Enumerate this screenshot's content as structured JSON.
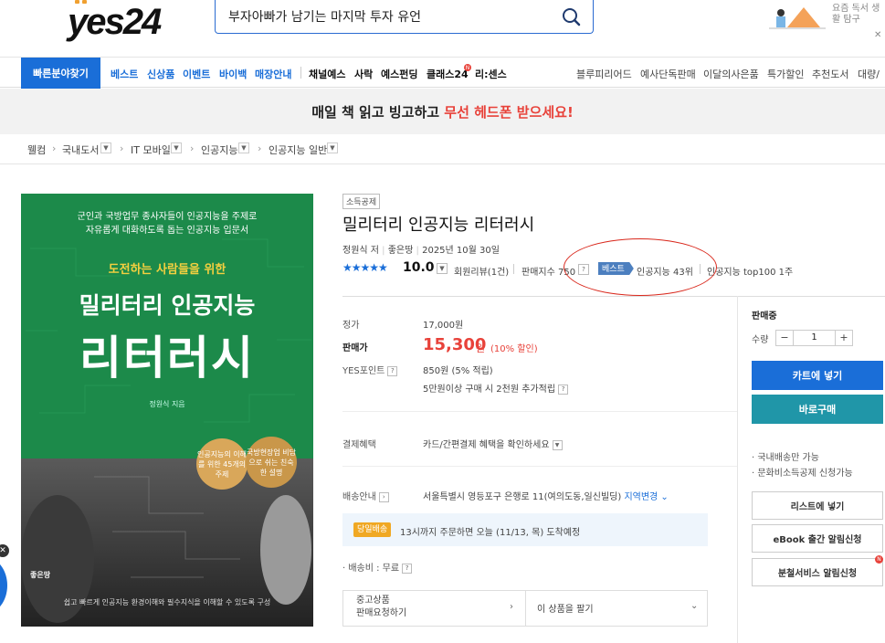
{
  "header": {
    "logo": "yes24",
    "search_value": "부자아빠가 남기는 마지막 투자 유언",
    "promo_text": "요즘 독서 생활 탐구"
  },
  "nav": {
    "quick_button": "빠른분야찾기",
    "blue_items": [
      "베스트",
      "신상품",
      "이벤트",
      "바이백",
      "매장안내"
    ],
    "dark_items": [
      "채널예스",
      "사락",
      "예스펀딩",
      "클래스24",
      "리:센스"
    ],
    "gray_items": [
      "블루피리어드",
      "예사단독판매",
      "이달의사은품",
      "특가할인",
      "추천도서",
      "대량/"
    ]
  },
  "banner": {
    "text_black": "매일 책 읽고 빙고하고 ",
    "text_red": "무선 헤드폰 받으세요!"
  },
  "breadcrumb": [
    "웰컴",
    "국내도서",
    "IT 모바일",
    "인공지능",
    "인공지능 일반"
  ],
  "cover": {
    "subtitle_line1": "군인과 국방업무 종사자들이 인공지능을 주제로",
    "subtitle_line2": "자유롭게 대화하도록 돕는 인공지능 입문서",
    "kicker": "도전하는 사람들을 위한",
    "title1": "밀리터리 인공지능",
    "title2": "리터러시",
    "author": "정원식 지음",
    "circle1": "인공지능의 이해를 위한 45개의 주제",
    "circle2": "국방현장업 비담으로 쉬는 친숙한 설명",
    "footer": "쉽고 빠르게 인공지능 환경이해와 필수지식을 이해할 수 있도록 구성",
    "publisher": "좋은땅"
  },
  "product": {
    "tag": "소득공제",
    "title": "밀리터리 인공지능 리터러시",
    "author": "정원식 저",
    "publisher": "좋은땅",
    "date": "2025년 10월 30일",
    "stars": "★★★★★",
    "score": "10.0",
    "reviews": "회원리뷰(1건)",
    "sales_index": "판매지수 750",
    "best_badge": "베스트",
    "rank1": "인공지능 43위",
    "rank2": "인공지능 top100 1주"
  },
  "price": {
    "list_label": "정가",
    "list_value": "17,000원",
    "sale_label": "판매가",
    "sale_value": "15,300",
    "sale_unit": "원",
    "discount": "(10% 할인)",
    "point_label": "YES포인트",
    "point_value": "850원 (5% 적립)",
    "point_extra": "5만원이상 구매 시 2천원 추가적립"
  },
  "benefit": {
    "label": "결제혜택",
    "value": "카드/간편결제 혜택을 확인하세요"
  },
  "delivery": {
    "label": "배송안내",
    "address": "서울특별시 영등포구 은행로 11(여의도동,일신빌딩)",
    "change": "지역변경",
    "sameday_badge": "당일배송",
    "sameday_text": "13시까지 주문하면 오늘 (11/13, 목) 도착예정",
    "fee": "· 배송비 : 무료"
  },
  "used": {
    "left_line1": "중고상품",
    "left_line2": "판매요청하기",
    "right": "이 상품을 팔기"
  },
  "side": {
    "status": "판매중",
    "qty_label": "수량",
    "qty_value": "1",
    "cart": "카트에 넣기",
    "buy": "바로구매",
    "note1": "· 국내배송만 가능",
    "note2": "· 문화비소득공제 신청가능",
    "list_btn": "리스트에 넣기",
    "ebook_btn": "eBook 출간 알림신청",
    "split_btn": "분철서비스 알림신청"
  },
  "colors": {
    "accent": "#1a6ed8",
    "sale": "#e8423a",
    "buy": "#2096a8",
    "cover": "#1c8a4a"
  }
}
